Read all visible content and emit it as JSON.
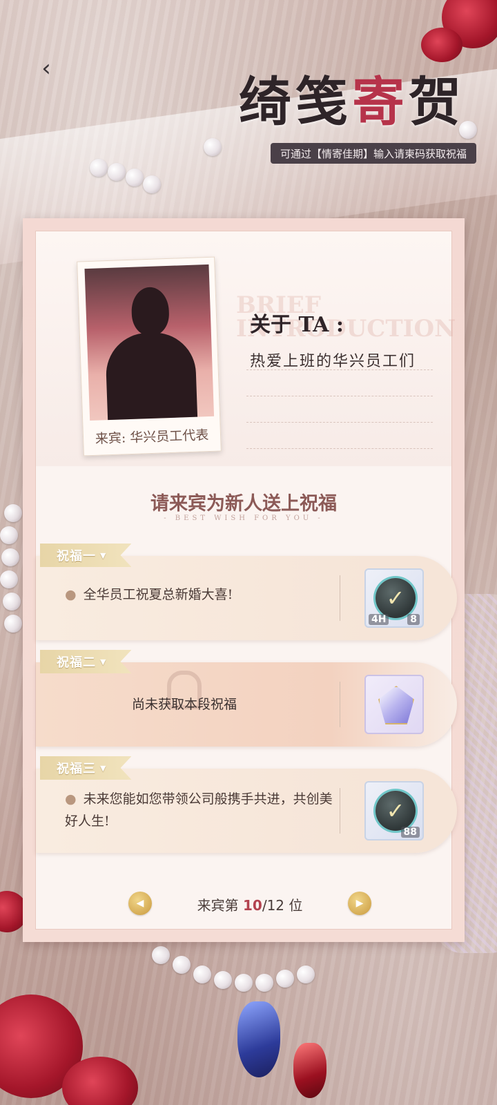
{
  "header": {
    "back_icon": "chevron-left-icon",
    "title_part1": "绮笺",
    "title_part2": "寄",
    "title_part3": "贺",
    "subtitle": "可通过【情寄佳期】输入请柬码获取祝福"
  },
  "guest": {
    "photo_caption": "来宾: 华兴员工代表",
    "about_label": "关于 TA :",
    "about_text": "热爱上班的华兴员工们",
    "watermark": "BRIEF INTRODUCTION"
  },
  "section": {
    "title": "请来宾为新人送上祝福",
    "subtitle": "- BEST WISH FOR YOU -"
  },
  "wishes": [
    {
      "tag": "祝福一",
      "text": "全华员工祝夏总新婚大喜!",
      "reward_icon": "check-badge-icon",
      "reward_left_label": "4H",
      "reward_count": "8"
    },
    {
      "tag": "祝福二",
      "locked_text": "尚未获取本段祝福",
      "reward_icon": "crystal-gem-icon"
    },
    {
      "tag": "祝福三",
      "text": "未来您能如您带领公司般携手共进，共创美好人生!",
      "reward_icon": "check-badge-icon",
      "reward_count": "88"
    }
  ],
  "pager": {
    "prefix": "来宾第",
    "current": "10",
    "total_suffix": "/12 位",
    "prev_icon": "prev-arrow-icon",
    "next_icon": "next-arrow-icon"
  },
  "colors": {
    "accent_red": "#b6334a",
    "gold": "#c9993d",
    "card_bg": "#fbf4f1"
  }
}
